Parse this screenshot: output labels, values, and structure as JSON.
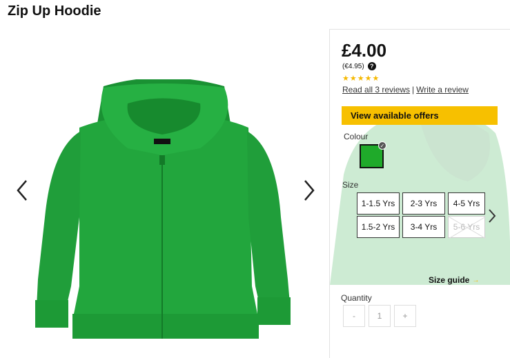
{
  "product": {
    "title": "Zip Up Hoodie",
    "price": "£4.00",
    "alt_price": "(€4.95)",
    "help_icon": "?",
    "rating_stars": "★★★★★",
    "rating_value": 5,
    "reviews_link": "Read all 3 reviews",
    "separator": "|",
    "write_review_link": "Write a review"
  },
  "offers": {
    "label": "View available offers",
    "color": "#f7c000"
  },
  "colour": {
    "label": "Colour",
    "selected_color": "#1faa2a",
    "check_icon": "✓"
  },
  "size": {
    "label": "Size",
    "options": [
      {
        "label": "1-1.5 Yrs",
        "available": true
      },
      {
        "label": "2-3 Yrs",
        "available": true
      },
      {
        "label": "4-5 Yrs",
        "available": true
      },
      {
        "label": "1.5-2 Yrs",
        "available": true
      },
      {
        "label": "3-4 Yrs",
        "available": true
      },
      {
        "label": "5-6 Yrs",
        "available": false
      }
    ],
    "guide_label": "Size guide",
    "guide_icon": "→"
  },
  "quantity": {
    "label": "Quantity",
    "minus": "-",
    "value": "1",
    "plus": "+"
  },
  "icons": {
    "gallery_prev": "chevron-left-icon",
    "gallery_next": "chevron-right-icon",
    "size_next": "chevron-right-icon"
  },
  "hoodie_color": "#20a23a"
}
